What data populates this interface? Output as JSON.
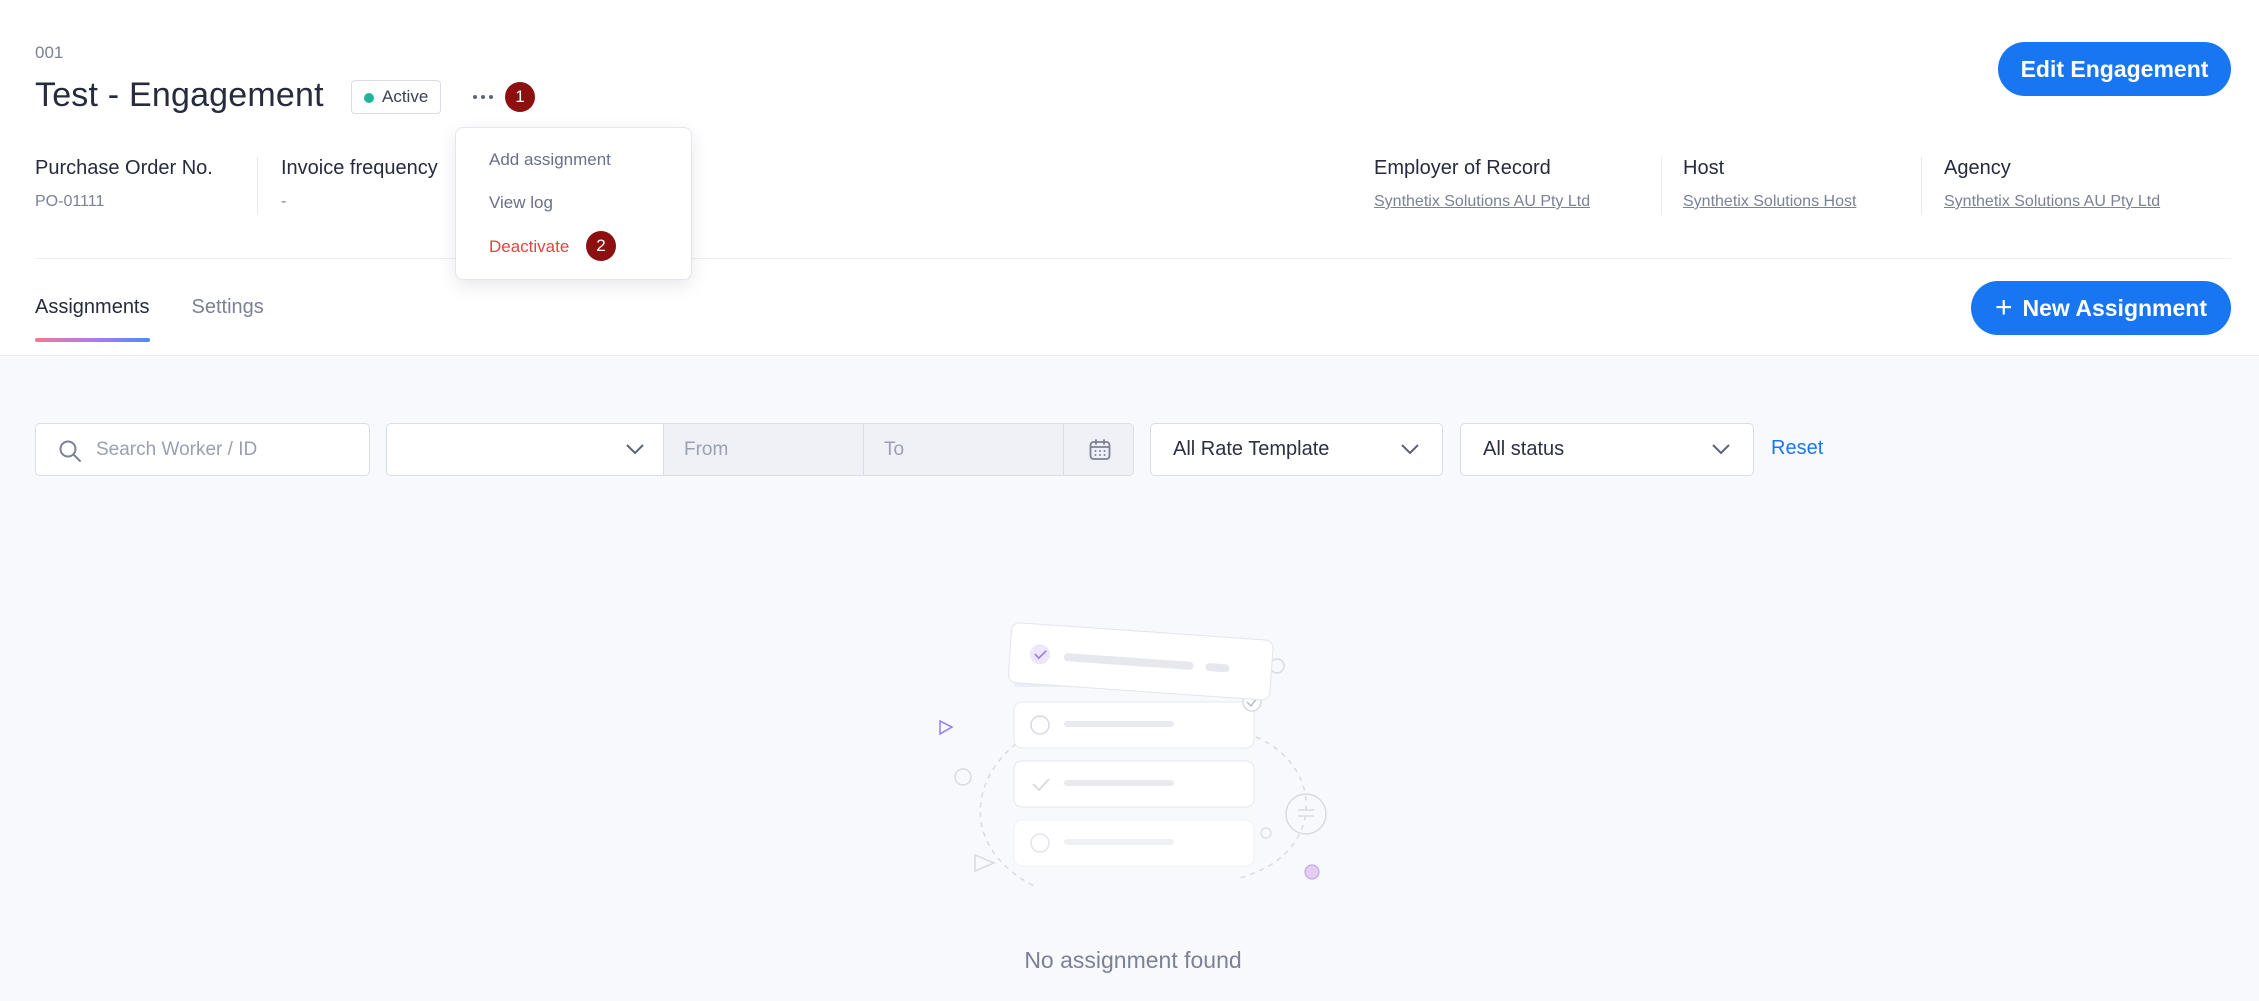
{
  "engagement": {
    "code": "001",
    "title": "Test - Engagement",
    "status": "Active",
    "status_color": "#20b59a"
  },
  "markers": {
    "first": "1",
    "second": "2"
  },
  "actions": {
    "edit_label": "Edit Engagement",
    "new_assignment_label": "New Assignment",
    "new_assignment_icon": "+"
  },
  "meta": {
    "po_label": "Purchase Order No.",
    "po_value": "PO-01111",
    "invoice_label": "Invoice frequency",
    "invoice_value": "-",
    "eor_label": "Employer of Record",
    "eor_value": "Synthetix Solutions AU Pty Ltd",
    "host_label": "Host",
    "host_value": "Synthetix Solutions Host",
    "agency_label": "Agency",
    "agency_value": "Synthetix Solutions AU Pty Ltd"
  },
  "tabs": [
    {
      "label": "Assignments",
      "active": true
    },
    {
      "label": "Settings",
      "active": false
    }
  ],
  "menu": {
    "items": [
      {
        "label": "Add assignment"
      },
      {
        "label": "View log"
      },
      {
        "label": "Deactivate"
      }
    ]
  },
  "filters": {
    "search_placeholder": "Search Worker / ID",
    "date_from_placeholder": "From",
    "date_to_placeholder": "To",
    "rate_template": "All Rate Template",
    "status": "All status",
    "reset_label": "Reset"
  },
  "empty_state": {
    "message": "No assignment found"
  },
  "colors": {
    "primary": "#1976f2",
    "danger": "#e0463b",
    "marker": "#8c1010"
  }
}
